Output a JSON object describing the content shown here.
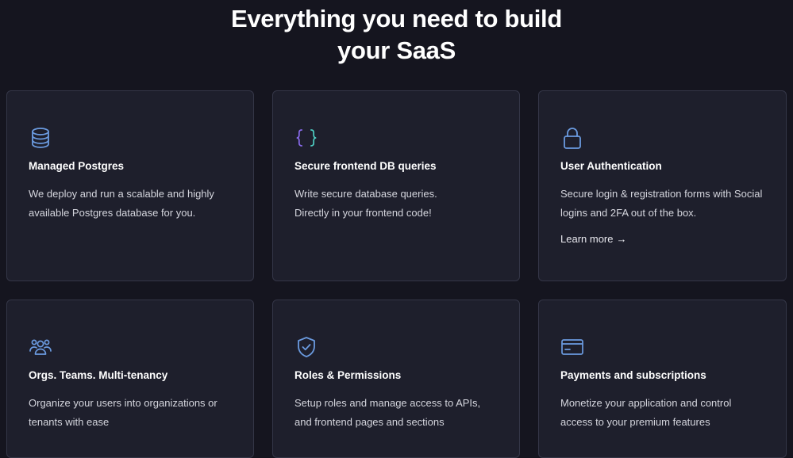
{
  "heading": {
    "line1": "Everything you need to build",
    "line2": "your SaaS"
  },
  "colors": {
    "background": "#15151f",
    "card": "#1e1f2c",
    "card_border": "#343647",
    "icon_blue": "#6b9be0",
    "icon_purple": "#8b6cf0",
    "icon_teal": "#4fd1c5"
  },
  "cards": [
    {
      "icon": "database-icon",
      "title": "Managed Postgres",
      "desc_line1": "We deploy and run a scalable and highly",
      "desc_line2": "available Postgres database for you."
    },
    {
      "icon": "code-braces-icon",
      "title": "Secure frontend DB queries",
      "desc_line1": "Write secure database queries.",
      "desc_line2": "Directly in your frontend code!"
    },
    {
      "icon": "lock-icon",
      "title": "User Authentication",
      "desc_line1": "Secure login & registration forms with Social",
      "desc_line2": "logins and 2FA out of the box.",
      "link": "Learn more",
      "link_arrow": "→"
    },
    {
      "icon": "users-group-icon",
      "title": "Orgs. Teams. Multi-tenancy",
      "desc_line1": "Organize your users into organizations or",
      "desc_line2": "tenants with ease"
    },
    {
      "icon": "shield-check-icon",
      "title": "Roles & Permissions",
      "desc_line1": "Setup roles and manage access to APIs,",
      "desc_line2": "and frontend pages and sections"
    },
    {
      "icon": "credit-card-icon",
      "title": "Payments and subscriptions",
      "desc_line1": "Monetize your application and control",
      "desc_line2": "access to your premium features"
    }
  ]
}
